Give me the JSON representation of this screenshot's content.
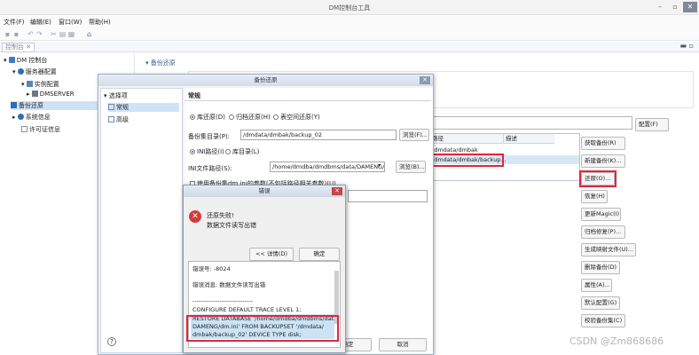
{
  "window": {
    "title": "DM控制台工具",
    "min": "–",
    "max": "▫",
    "close": "✕"
  },
  "menu": [
    "文件(F)",
    "编辑(E)",
    "窗口(W)",
    "帮助(H)"
  ],
  "view_tab": {
    "label": "控制台",
    "close": "✕"
  },
  "tree": {
    "root": "DM 控制台",
    "server_config": "服务器配置",
    "instance_config": "实例配置",
    "dmserver": "DMSERVER",
    "backup_restore": "备份还原",
    "system_info": "系统信息",
    "license_info": "许可证信息"
  },
  "panel": {
    "section_title": "备份还原",
    "config_button": "配置(F)",
    "grid_headers": [
      "路径",
      "描述"
    ],
    "grid_rows": [
      "/dmdata/dmbak",
      "/dmdata/dmbak/backup..."
    ],
    "side_buttons": [
      "获取备份(R)",
      "新建备份(K)...",
      "还原(O)...",
      "恢复(H)",
      "更新Magic(I)",
      "归档修复(P)...",
      "生成映射文件(U)...",
      "删除备份(D)",
      "属性(A)...",
      "默认配置(G)",
      "校验备份集(C)"
    ]
  },
  "restore_dialog": {
    "title": "备份还原",
    "nav_group": "选择项",
    "nav_items": [
      "常规",
      "高级"
    ],
    "section": "常规",
    "radio_db": "库还原(D)",
    "radio_archive": "归档还原(H)",
    "radio_tablespace": "表空间还原(Y)",
    "backup_dir_label": "备份集目录(P):",
    "backup_dir_value": "/dmdata/dmbak/backup_02",
    "browse_f": "浏览(F)...",
    "radio_ini": "INI路径(I)",
    "radio_dir": "库目录(L)",
    "ini_label": "INI文件路径(S):",
    "ini_value": "/home/dmdba/dmdbms/data/DAMENG/dm.ini",
    "browse_b": "浏览(B)...",
    "use_params": "使用备份集dm.ini的参数(不包括路径相关参数)(U)",
    "ok": "确定",
    "cancel": "取消",
    "help": "?"
  },
  "error_dialog": {
    "title": "错误",
    "msg1": "还原失败!",
    "msg2": "数据文件读写出错",
    "details_button": "<< 详情(D)",
    "ok": "确定",
    "detail_lines": [
      "错误号: -8024",
      "错误消息: 数据文件读写出错",
      "-----------------------------",
      "CONFIGURE DEFAULT TRACE LEVEL 1;",
      "RESTORE DATABASE '/home/dmdba/dmdbms/data/",
      "DAMENG/dm.ini' FROM BACKUPSET '/dmdata/",
      "dmbak/backup_02' DEVICE TYPE disk;"
    ]
  },
  "watermark": "CSDN @Zm868686"
}
